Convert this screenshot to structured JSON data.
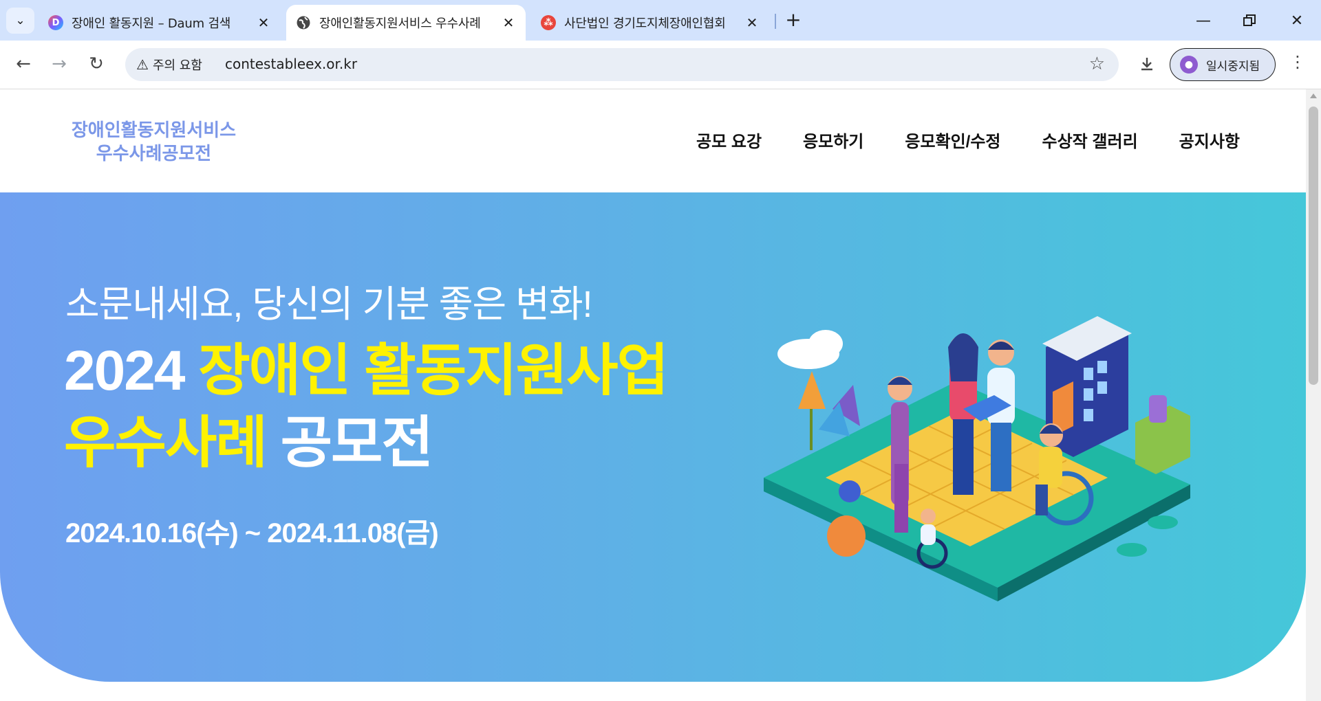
{
  "browser": {
    "tabs": [
      {
        "title": "장애인 활동지원 – Daum 검색",
        "favicon": "daum-icon",
        "active": false
      },
      {
        "title": "장애인활동지원서비스 우수사례",
        "favicon": "globe-icon",
        "active": true
      },
      {
        "title": "사단법인 경기도지체장애인협회",
        "favicon": "association-icon",
        "active": false
      }
    ],
    "security_label": "주의 요함",
    "url": "contestableex.or.kr",
    "profile_label": "일시중지됨"
  },
  "site": {
    "logo_line1": "장애인활동지원서비스",
    "logo_line2": "우수사례공모전",
    "nav": [
      "공모 요강",
      "응모하기",
      "응모확인/수정",
      "수상작 갤러리",
      "공지사항"
    ]
  },
  "hero": {
    "tagline": "소문내세요, 당신의 기분 좋은 변화!",
    "headline_year": "2024",
    "headline_highlight1": "장애인 활동지원사업",
    "headline_highlight2": "우수사례",
    "headline_tail": "공모전",
    "period": "2024.10.16(수) ~ 2024.11.08(금)"
  },
  "colors": {
    "accent_yellow": "#fff200",
    "logo_blue": "#7b97e8",
    "hero_gradient_start": "#6f9ff0",
    "hero_gradient_end": "#45c7d9",
    "tabstrip": "#d3e3fd"
  }
}
